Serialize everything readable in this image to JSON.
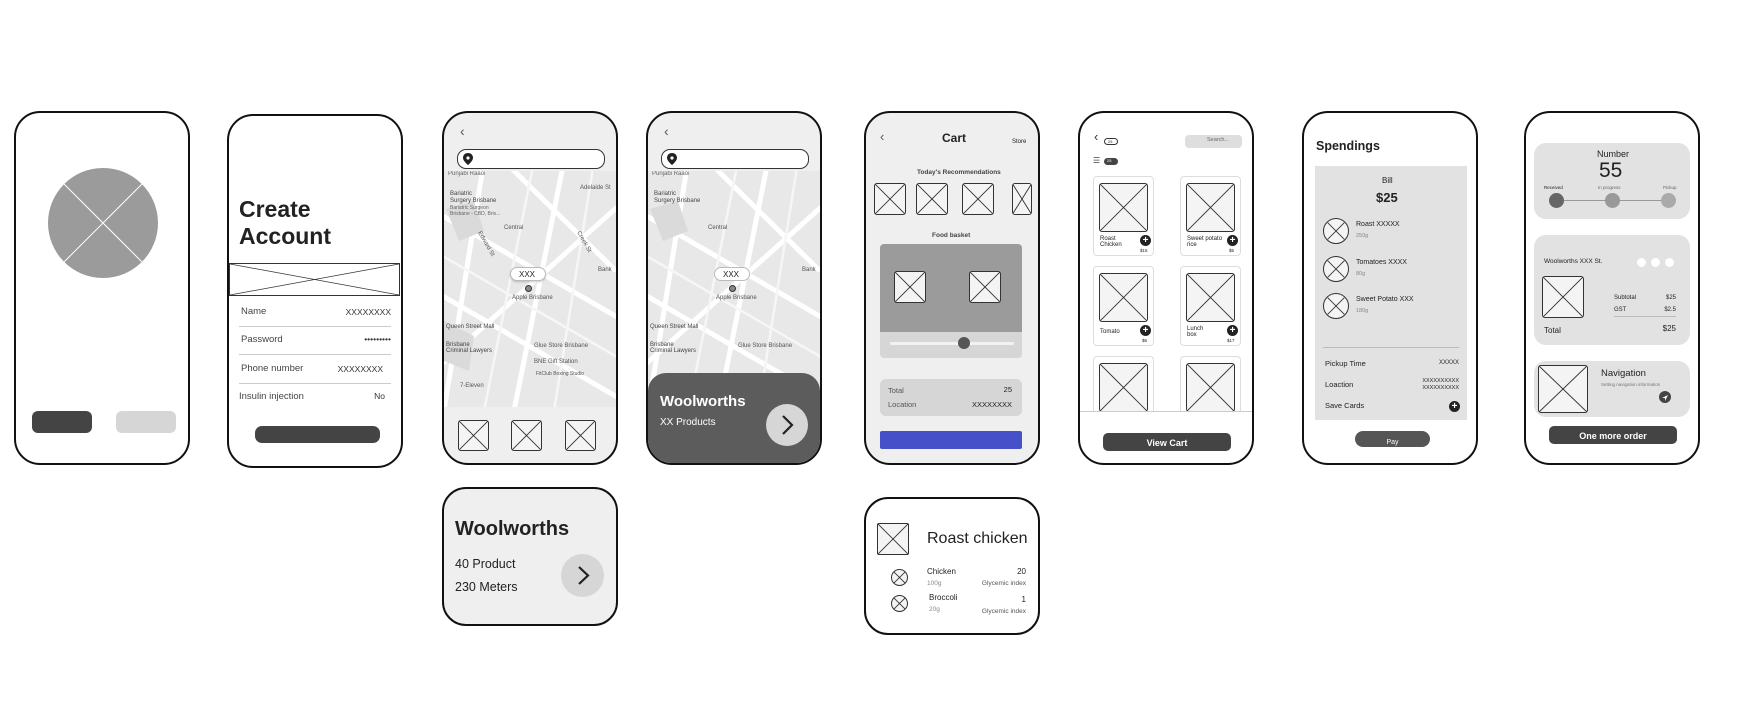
{
  "create_account": {
    "title_line1": "Create",
    "title_line2": "Account",
    "fields": [
      {
        "label": "Name",
        "value": "XXXXXXXX"
      },
      {
        "label": "Password",
        "value": "•••••••••"
      },
      {
        "label": "Phone number",
        "value": "XXXXXXXX"
      },
      {
        "label": "Insulin injection",
        "value": "No"
      }
    ]
  },
  "map": {
    "marker_label": "XXX",
    "places": [
      "Punjabi Raaoi",
      "Bariatric",
      "Surgery Brisbane",
      "Bariatric Surgeon",
      "Brisbane - CBD, Bris...",
      "Central",
      "Adelaide St",
      "Student Accommodation",
      "Creek St",
      "Edward St",
      "Apple Brisbane",
      "Bank",
      "Queen Street Mall",
      "Brisbane",
      "Criminal Lawyers",
      "Glue Store Brisbane",
      "BNE Gift Station",
      "FitClub Boxing Studio",
      "7-Eleven",
      "Charlotte St",
      "Albert St",
      "Mary St"
    ]
  },
  "store_card": {
    "name": "Woolworths",
    "products": "XX Products"
  },
  "store_popup": {
    "name": "Woolworths",
    "products": "40 Product",
    "distance": "230 Meters"
  },
  "cart": {
    "title": "Cart",
    "store": "Store",
    "recommendations": "Today's Recommendations",
    "basket": "Food basket",
    "total_label": "Total",
    "total_value": "25",
    "location_label": "Location",
    "location_value": "XXXXXXXX"
  },
  "nutrition": {
    "title": "Roast chicken",
    "items": [
      {
        "name": "Chicken",
        "weight": "100g",
        "value": "20",
        "metric": "Glycemic index"
      },
      {
        "name": "Broccoli",
        "weight": "20g",
        "value": "1",
        "metric": "Glycemic index"
      }
    ]
  },
  "shop": {
    "search_placeholder": "Search...",
    "badge1": "25",
    "badge2": "25",
    "products": [
      {
        "name": "Roast Chicken",
        "price": "$15"
      },
      {
        "name": "Sweet potato rice",
        "price": "$5"
      },
      {
        "name": "Tomato",
        "price": "$6"
      },
      {
        "name": "Lunch box",
        "price": "$17"
      }
    ],
    "view_cart": "View Cart"
  },
  "spendings": {
    "title": "Spendings",
    "bill_label": "Bill",
    "bill_amount": "$25",
    "items": [
      {
        "name": "Roast XXXXX",
        "weight": "250g"
      },
      {
        "name": "Tomatoes XXXX",
        "weight": "80g"
      },
      {
        "name": "Sweet Potato XXX",
        "weight": "180g"
      }
    ],
    "pickup_label": "Pickup Time",
    "pickup_value": "XXXXX",
    "location_label": "Loaction",
    "location_value1": "XXXXXXXXXX",
    "location_value2": "XXXXXXXXXX",
    "save_cards": "Save Cards",
    "pay": "Pay"
  },
  "order": {
    "number_label": "Number",
    "number": "55",
    "steps": [
      "Received",
      "In progress",
      "Pickup"
    ],
    "store": "Woolworths XXX St.",
    "subtotal_label": "Subtotal",
    "subtotal_value": "$25",
    "gst_label": "GST",
    "gst_value": "$2.5",
    "total_label": "Total",
    "total_value": "$25",
    "nav_title": "Navigation",
    "nav_sub": "Setting navigation information",
    "one_more": "One more order"
  },
  "colors": {
    "dark_button": "#444444",
    "light_button": "#d6d6d6",
    "accent_blue": "#4650c8",
    "placeholder_gray": "#9b9b9b",
    "panel_gray": "#e2e2e2"
  }
}
